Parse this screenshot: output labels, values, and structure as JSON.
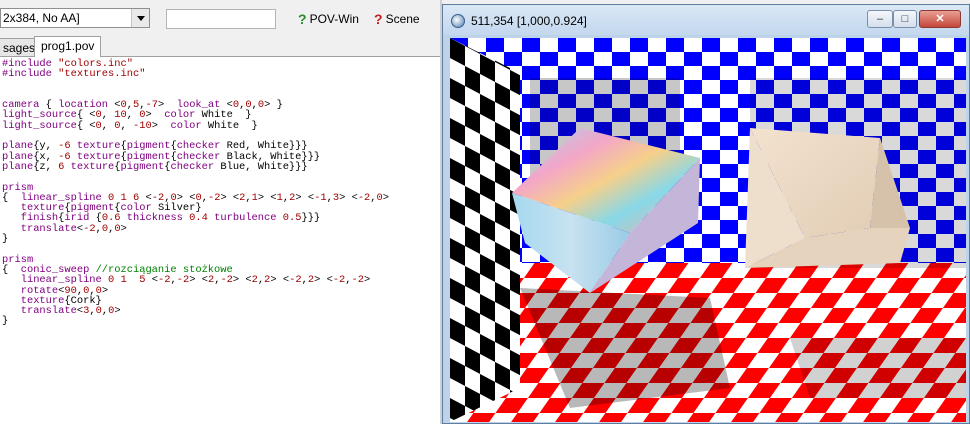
{
  "toolbar": {
    "resolution_value": "2x384, No AA]",
    "search_value": "",
    "povwin_label": "POV-Win",
    "scene_label": "Scene"
  },
  "tabs": [
    {
      "label": "sages"
    },
    {
      "label": "prog1.pov"
    }
  ],
  "editor": {
    "lines": [
      "#include \"colors.inc\"",
      "#include \"textures.inc\"",
      "",
      "",
      "camera { location <0,5,-7>  look_at <0,0,0> }",
      "light_source{ <0, 10, 0>  color White  }",
      "light_source{ <0, 0, -10>  color White  }",
      "",
      "plane{y, -6 texture{pigment{checker Red, White}}}",
      "plane{x, -6 texture{pigment{checker Black, White}}}",
      "plane{z, 6 texture{pigment{checker Blue, White}}}",
      "",
      "prism",
      "{  linear_spline 0 1 6 <-2,0> <0,-2> <2,1> <1,2> <-1,3> <-2,0>",
      "   texture{pigment{color Silver}",
      "   finish{irid {0.6 thickness 0.4 turbulence 0.5}}}",
      "   translate<-2,0,0>",
      "}",
      "",
      "prism",
      "{  conic_sweep //rozciąganie stożkowe",
      "   linear_spline 0 1  5 <-2,-2> <2,-2> <2,2> <-2,2> <-2,-2>",
      "   rotate<90,0,0>",
      "   texture{Cork}",
      "   translate<3,0,0>",
      "}"
    ]
  },
  "render_window": {
    "title": "511,354 [1,000,0.924]",
    "min_label": "–",
    "max_label": "□",
    "close_label": "✕"
  },
  "colors": {
    "checker_red": "#ff0000",
    "checker_blue": "#0000ff",
    "checker_black": "#000000"
  }
}
